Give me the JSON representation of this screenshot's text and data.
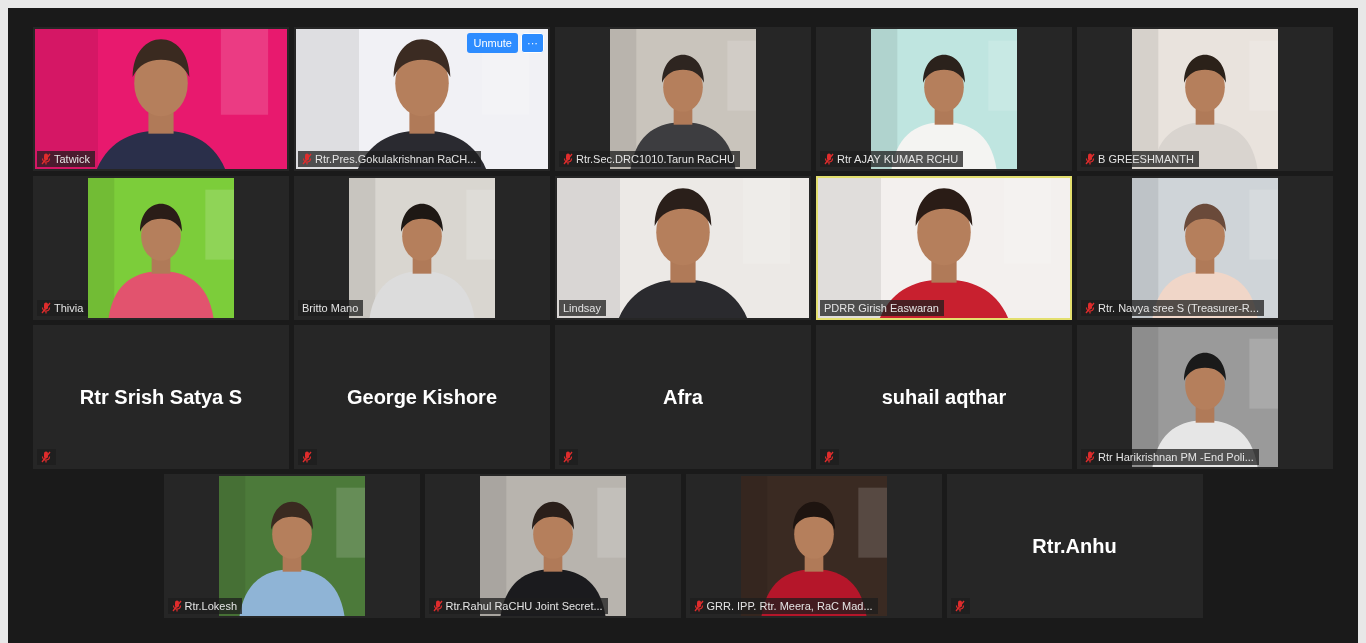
{
  "tiles": [
    {
      "name": "Tatwick",
      "muted": true,
      "kind": "video_wide",
      "active": false
    },
    {
      "name": "Rtr.Pres.Gokulakrishnan RaCH...",
      "muted": true,
      "kind": "video_wide",
      "active": false,
      "hover_buttons": [
        "Unmute",
        "···"
      ]
    },
    {
      "name": "Rtr.Sec.DRC1010.Tarun RaCHU",
      "muted": true,
      "kind": "video_4x3",
      "active": false
    },
    {
      "name": "Rtr AJAY KUMAR RCHU",
      "muted": true,
      "kind": "video_4x3",
      "active": false
    },
    {
      "name": "B GREESHMANTH",
      "muted": true,
      "kind": "video_4x3",
      "active": false
    },
    {
      "name": "Thivia",
      "muted": true,
      "kind": "video_4x3",
      "active": false
    },
    {
      "name": "Britto Mano",
      "muted": false,
      "kind": "video_4x3",
      "active": false
    },
    {
      "name": "Lindsay",
      "muted": false,
      "kind": "video_wide",
      "active": false
    },
    {
      "name": "PDRR Girish Easwaran",
      "muted": false,
      "kind": "video_wide",
      "active": true
    },
    {
      "name": "Rtr. Navya sree S (Treasurer-R...",
      "muted": true,
      "kind": "video_4x3",
      "active": false
    },
    {
      "name": "Rtr Srish Satya S",
      "muted": true,
      "kind": "name",
      "active": false
    },
    {
      "name": "George Kishore",
      "muted": true,
      "kind": "name",
      "active": false
    },
    {
      "name": "Afra",
      "muted": true,
      "kind": "name",
      "active": false
    },
    {
      "name": "suhail aqthar",
      "muted": true,
      "kind": "name",
      "active": false
    },
    {
      "name": "Rtr Harikrishnan PM -End Poli...",
      "muted": true,
      "kind": "video_4x3",
      "active": false
    },
    {
      "name": "Rtr.Lokesh",
      "muted": true,
      "kind": "video_4x3",
      "active": false
    },
    {
      "name": "Rtr.Rahul RaCHU Joint Secret...",
      "muted": true,
      "kind": "video_4x3",
      "active": false
    },
    {
      "name": "GRR. IPP. Rtr. Meera, RaC Mad...",
      "muted": true,
      "kind": "video_4x3",
      "active": false
    },
    {
      "name": "Rtr.Anhu",
      "muted": true,
      "kind": "name",
      "active": false
    }
  ]
}
